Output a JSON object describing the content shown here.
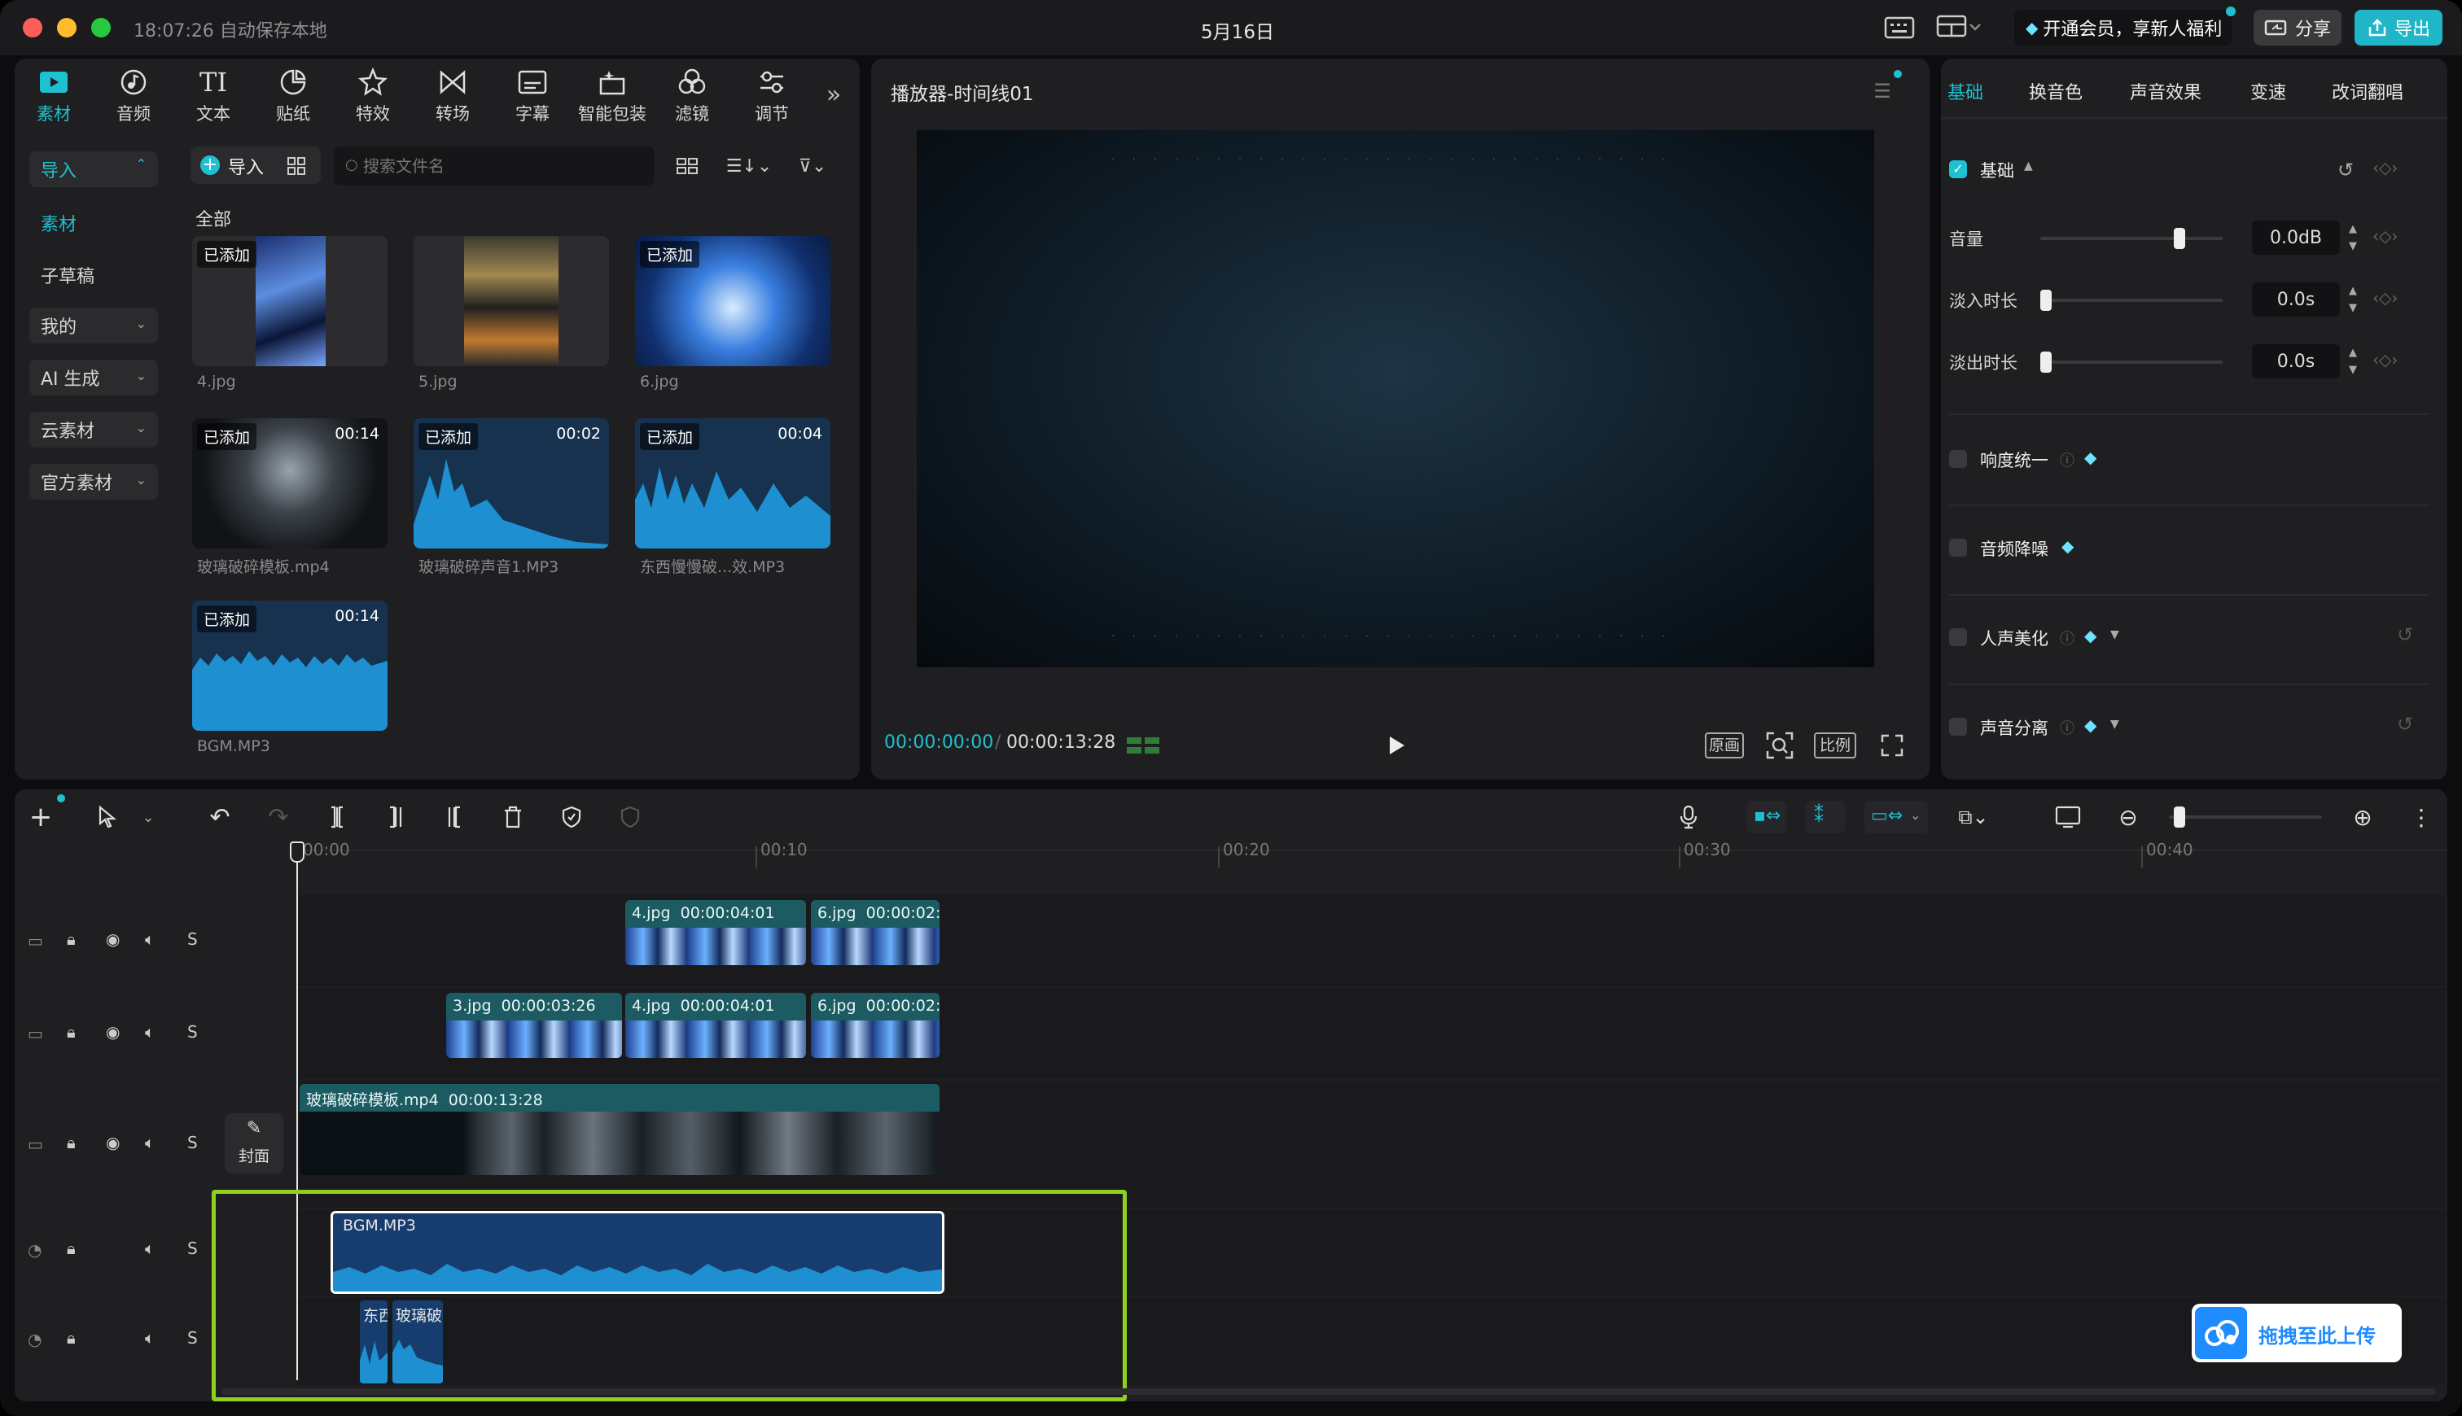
{
  "titlebar": {
    "time_status": "18:07:26 自动保存本地",
    "project_name": "5月16日",
    "vip_label": "开通会员，享新人福利",
    "share_label": "分享",
    "export_label": "导出"
  },
  "toolbar": {
    "items": [
      {
        "label": "素材",
        "icon": "media-icon"
      },
      {
        "label": "音频",
        "icon": "audio-icon"
      },
      {
        "label": "文本",
        "icon": "text-icon"
      },
      {
        "label": "贴纸",
        "icon": "sticker-icon"
      },
      {
        "label": "特效",
        "icon": "effects-icon"
      },
      {
        "label": "转场",
        "icon": "transition-icon"
      },
      {
        "label": "字幕",
        "icon": "subtitle-icon"
      },
      {
        "label": "智能包装",
        "icon": "smart-package-icon"
      },
      {
        "label": "滤镜",
        "icon": "filter-icon"
      },
      {
        "label": "调节",
        "icon": "adjust-icon"
      }
    ]
  },
  "sidebar": {
    "items": [
      {
        "label": "导入"
      },
      {
        "label": "素材"
      },
      {
        "label": "子草稿"
      },
      {
        "label": "我的"
      },
      {
        "label": "AI 生成"
      },
      {
        "label": "云素材"
      },
      {
        "label": "官方素材"
      }
    ]
  },
  "media": {
    "import_label": "导入",
    "search_placeholder": "搜索文件名",
    "section_label": "全部",
    "added_badge": "已添加",
    "items": [
      {
        "name": "4.jpg",
        "added": true,
        "duration": ""
      },
      {
        "name": "5.jpg",
        "added": false,
        "duration": ""
      },
      {
        "name": "6.jpg",
        "added": true,
        "duration": ""
      },
      {
        "name": "玻璃破碎模板.mp4",
        "added": true,
        "duration": "00:14"
      },
      {
        "name": "玻璃破碎声音1.MP3",
        "added": true,
        "duration": "00:02"
      },
      {
        "name": "东西慢慢破...效.MP3",
        "added": true,
        "duration": "00:04"
      },
      {
        "name": "BGM.MP3",
        "added": true,
        "duration": "00:14"
      }
    ]
  },
  "player": {
    "title": "播放器-时间线01",
    "current_time": "00:00:00:00",
    "total_time": "00:00:13:28",
    "original_label": "原画",
    "ratio_label": "比例"
  },
  "right_panel": {
    "tabs": [
      "基础",
      "换音色",
      "声音效果",
      "变速",
      "改词翻唱"
    ],
    "basic_label": "基础",
    "params": [
      {
        "label": "音量",
        "value": "0.0dB",
        "level": 0.78
      },
      {
        "label": "淡入时长",
        "value": "0.0s",
        "level": 0
      },
      {
        "label": "淡出时长",
        "value": "0.0s",
        "level": 0
      }
    ],
    "options": [
      "响度统一",
      "音频降噪",
      "人声美化",
      "声音分离"
    ]
  },
  "timeline": {
    "ruler": [
      "00:00",
      "00:10",
      "00:20",
      "00:30",
      "00:40"
    ],
    "cover_label": "封面",
    "track_s": "S",
    "clips_track1": [
      {
        "label": "4.jpg",
        "time": "00:00:04:01"
      },
      {
        "label": "6.jpg",
        "time": "00:00:02:"
      }
    ],
    "clips_track2": [
      {
        "label": "3.jpg",
        "time": "00:00:03:26"
      },
      {
        "label": "4.jpg",
        "time": "00:00:04:01"
      },
      {
        "label": "6.jpg",
        "time": "00:00:02:"
      }
    ],
    "main_clip": {
      "label": "玻璃破碎模板.mp4",
      "time": "00:00:13:28"
    },
    "audio_clip": {
      "label": "BGM.MP3"
    },
    "sfx_clips": [
      {
        "label": "东西"
      },
      {
        "label": "玻璃破"
      }
    ],
    "upload_label": "拖拽至此上传"
  },
  "colors": {
    "accent": "#1fc0cf",
    "highlight_box": "#8fd11f"
  }
}
